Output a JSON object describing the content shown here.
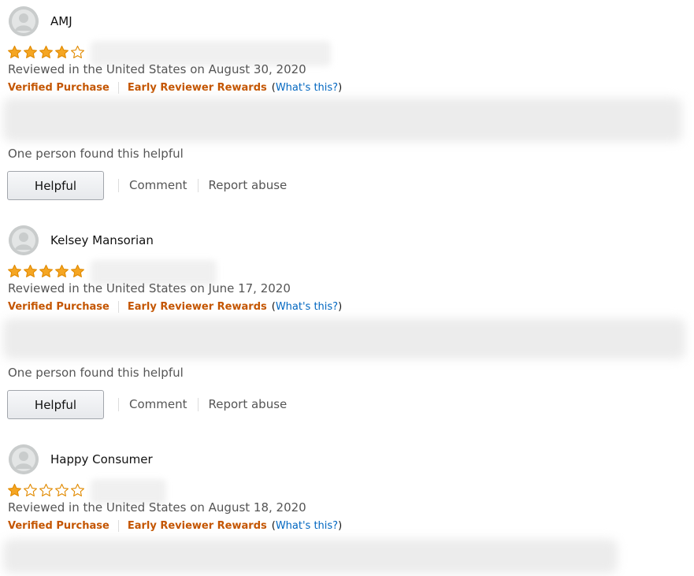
{
  "colors": {
    "star_fill": "#f5a623",
    "star_stroke": "#e18a00",
    "verified": "#c45500",
    "link": "#0066c0"
  },
  "reviews": [
    {
      "reviewer": "AMJ",
      "rating": 4,
      "location_date": "Reviewed in the United States on August 30, 2020",
      "verified": "Verified Purchase",
      "rewards": "Early Reviewer Rewards",
      "whats_this": "What's this?",
      "helpful_count": "One person found this helpful",
      "helpful_button": "Helpful",
      "comment": "Comment",
      "report": "Report abuse"
    },
    {
      "reviewer": "Kelsey Mansorian",
      "rating": 5,
      "location_date": "Reviewed in the United States on June 17, 2020",
      "verified": "Verified Purchase",
      "rewards": "Early Reviewer Rewards",
      "whats_this": "What's this?",
      "helpful_count": "One person found this helpful",
      "helpful_button": "Helpful",
      "comment": "Comment",
      "report": "Report abuse"
    },
    {
      "reviewer": "Happy Consumer",
      "rating": 1,
      "location_date": "Reviewed in the United States on August 18, 2020",
      "verified": "Verified Purchase",
      "rewards": "Early Reviewer Rewards",
      "whats_this": "What's this?"
    }
  ]
}
